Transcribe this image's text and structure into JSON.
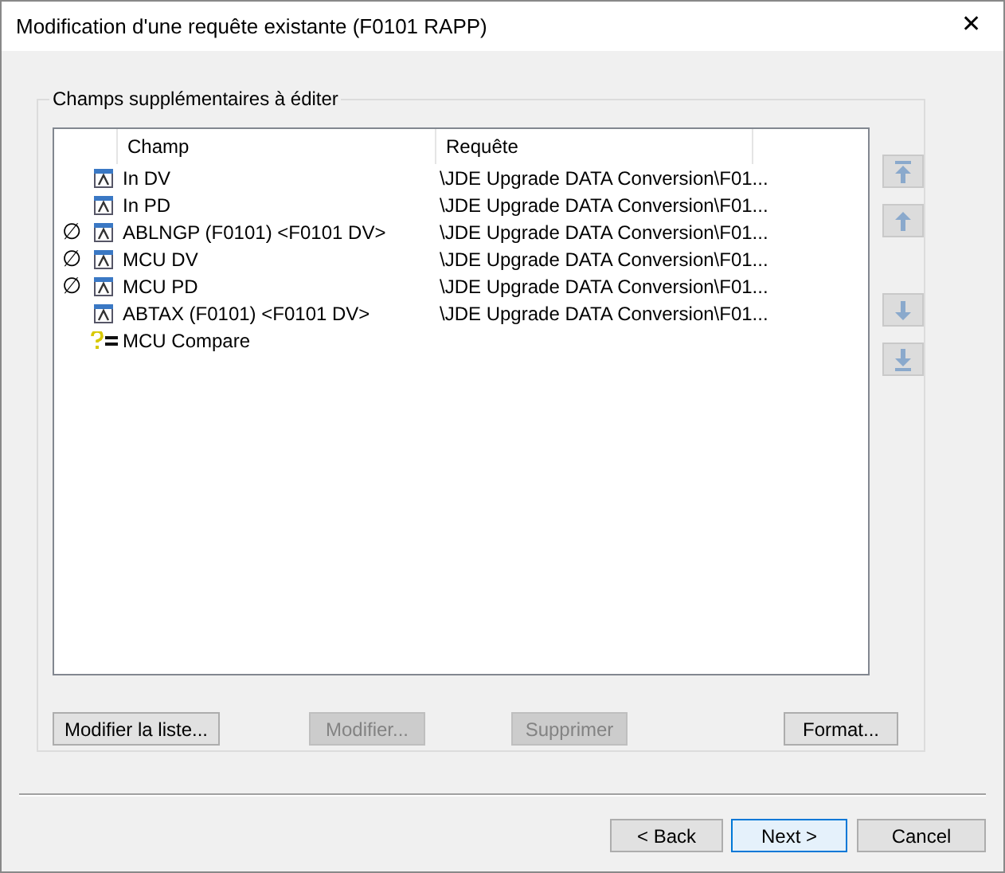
{
  "window": {
    "title": "Modification d'une requête existante (F0101 RAPP)",
    "close": "✕"
  },
  "group": {
    "title": "Champs supplémentaires à éditer"
  },
  "list": {
    "columns": [
      "Champ",
      "Requête"
    ],
    "rows": [
      {
        "kind": "field",
        "champ": "In DV",
        "requete": "\\JDE Upgrade DATA Conversion\\F01..."
      },
      {
        "kind": "field",
        "champ": "In PD",
        "requete": "\\JDE Upgrade DATA Conversion\\F01..."
      },
      {
        "flag": "∅",
        "kind": "field",
        "champ": "ABLNGP (F0101) <F0101 DV>",
        "requete": "\\JDE Upgrade DATA Conversion\\F01..."
      },
      {
        "flag": "∅",
        "kind": "field",
        "champ": "MCU DV",
        "requete": "\\JDE Upgrade DATA Conversion\\F01..."
      },
      {
        "flag": "∅",
        "kind": "field",
        "champ": "MCU PD",
        "requete": "\\JDE Upgrade DATA Conversion\\F01..."
      },
      {
        "kind": "field",
        "champ": "ABTAX (F0101) <F0101 DV>",
        "requete": "\\JDE Upgrade DATA Conversion\\F01..."
      },
      {
        "kind": "formula",
        "champ": "MCU Compare"
      }
    ]
  },
  "move_buttons": [
    {
      "kind": "top",
      "disabled": true
    },
    {
      "kind": "up",
      "disabled": true
    },
    {
      "kind": "down",
      "disabled": true
    },
    {
      "kind": "bottom",
      "disabled": true
    }
  ],
  "list_buttons": [
    {
      "label": "Modifier la liste...",
      "disabled": false
    },
    {
      "label": "Modifier...",
      "disabled": true
    },
    {
      "label": "Supprimer",
      "disabled": true
    },
    {
      "label": "Format...",
      "disabled": false
    }
  ],
  "wizard_buttons": [
    {
      "label": "< Back",
      "default": false
    },
    {
      "label": "Next >",
      "default": true
    },
    {
      "label": "Cancel",
      "default": false
    }
  ]
}
